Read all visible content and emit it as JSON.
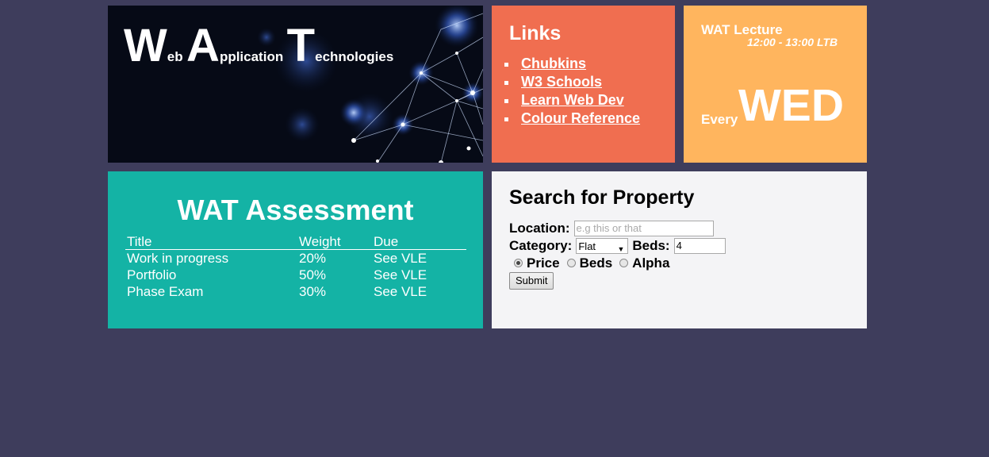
{
  "banner": {
    "title_letters": [
      {
        "big": "W",
        "small": "eb"
      },
      {
        "big": "A",
        "small": "pplication"
      },
      {
        "big": "T",
        "small": "echnologies"
      }
    ]
  },
  "links": {
    "heading": "Links",
    "items": [
      "Chubkins",
      "W3 Schools",
      "Learn Web Dev",
      "Colour Reference"
    ]
  },
  "lecture": {
    "title": "WAT Lecture",
    "time": "12:00 - 13:00 LTB",
    "every": "Every",
    "day": "WED"
  },
  "assessment": {
    "title": "WAT Assessment",
    "columns": [
      "Title",
      "Weight",
      "Due"
    ],
    "rows": [
      [
        "Work in progress",
        "20%",
        "See VLE"
      ],
      [
        "Portfolio",
        "50%",
        "See VLE"
      ],
      [
        "Phase Exam",
        "30%",
        "See VLE"
      ]
    ]
  },
  "search": {
    "heading": "Search for Property",
    "location_label": "Location:",
    "location_placeholder": "e.g this or that",
    "category_label": "Category:",
    "category_selected": "Flat",
    "beds_label": "Beds:",
    "beds_value": "4",
    "sort_options": [
      "Price",
      "Beds",
      "Alpha"
    ],
    "sort_selected": "Price",
    "submit_label": "Submit"
  },
  "colors": {
    "page_bg": "#3e3d5c",
    "links_bg": "#f06e50",
    "lecture_bg": "#ffb55e",
    "assessment_bg": "#14b3a5",
    "search_bg": "#f4f4f6"
  }
}
